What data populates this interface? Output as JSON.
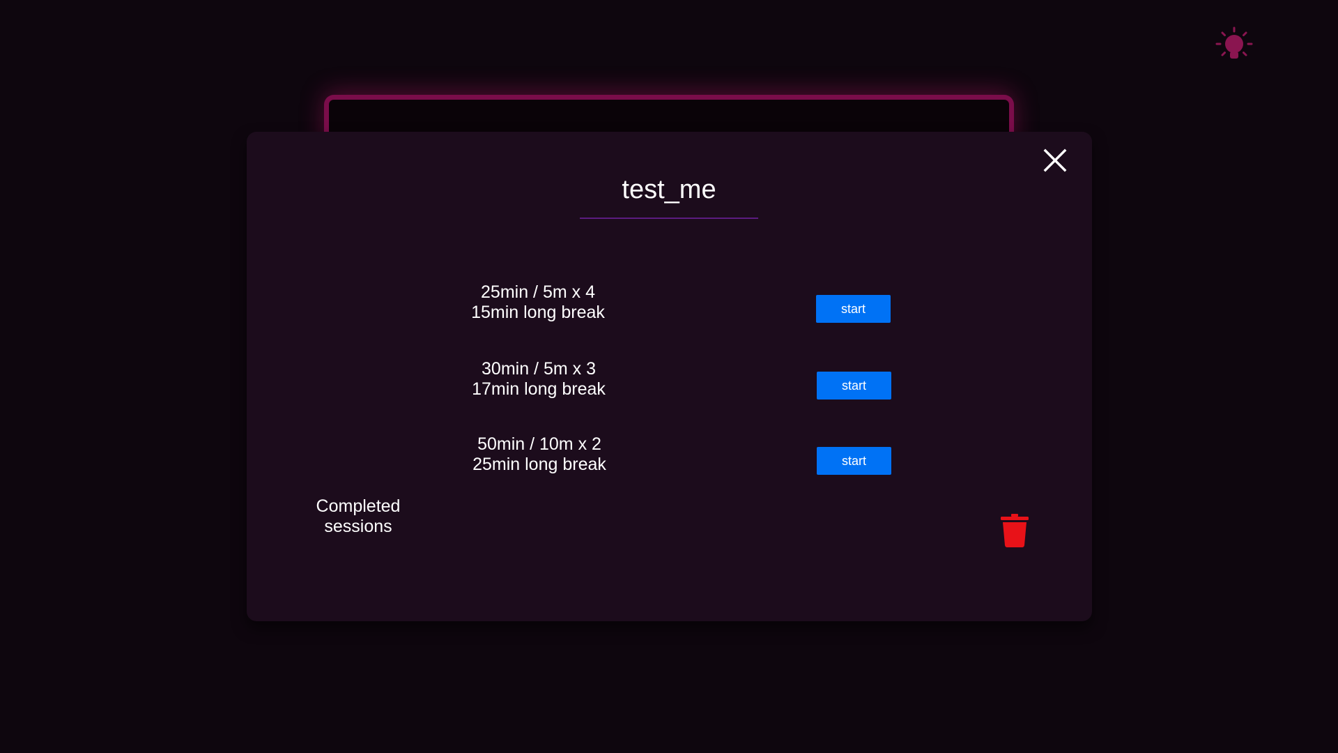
{
  "icons": {
    "theme_toggle": "lightbulb-icon",
    "close": "close-icon",
    "delete": "trash-icon"
  },
  "colors": {
    "background": "#0e060e",
    "modal": "#1c0c1c",
    "accent_frame": "#7a0d4a",
    "bulb": "#8a1550",
    "title_underline": "#5b1c80",
    "start_button": "#0072f5",
    "trash": "#e81218"
  },
  "modal": {
    "title": "test_me",
    "presets": [
      {
        "line1": "25min / 5m x 4",
        "line2": "15min long break",
        "button_label": "start"
      },
      {
        "line1": "30min / 5m x 3",
        "line2": "17min long break",
        "button_label": "start"
      },
      {
        "line1": "50min / 10m x 2",
        "line2": "25min long break",
        "button_label": "start"
      }
    ],
    "completed_label_line1": "Completed",
    "completed_label_line2": "sessions"
  }
}
